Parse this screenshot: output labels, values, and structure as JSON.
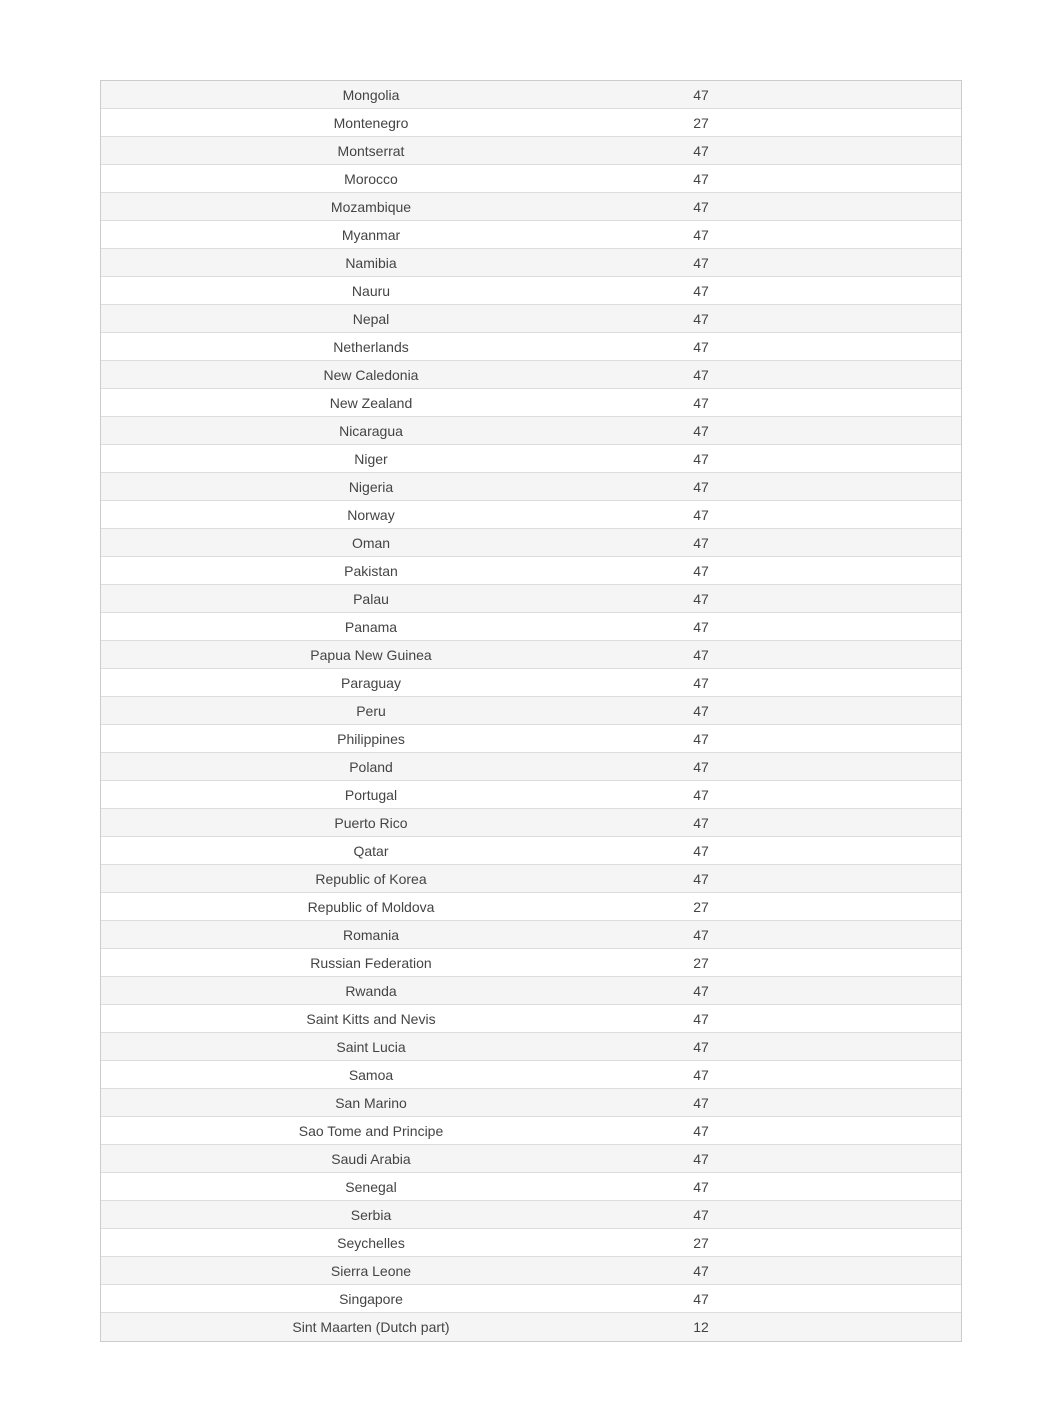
{
  "rows": [
    {
      "country": "Mongolia",
      "value": "47"
    },
    {
      "country": "Montenegro",
      "value": "27"
    },
    {
      "country": "Montserrat",
      "value": "47"
    },
    {
      "country": "Morocco",
      "value": "47"
    },
    {
      "country": "Mozambique",
      "value": "47"
    },
    {
      "country": "Myanmar",
      "value": "47"
    },
    {
      "country": "Namibia",
      "value": "47"
    },
    {
      "country": "Nauru",
      "value": "47"
    },
    {
      "country": "Nepal",
      "value": "47"
    },
    {
      "country": "Netherlands",
      "value": "47"
    },
    {
      "country": "New Caledonia",
      "value": "47"
    },
    {
      "country": "New Zealand",
      "value": "47"
    },
    {
      "country": "Nicaragua",
      "value": "47"
    },
    {
      "country": "Niger",
      "value": "47"
    },
    {
      "country": "Nigeria",
      "value": "47"
    },
    {
      "country": "Norway",
      "value": "47"
    },
    {
      "country": "Oman",
      "value": "47"
    },
    {
      "country": "Pakistan",
      "value": "47"
    },
    {
      "country": "Palau",
      "value": "47"
    },
    {
      "country": "Panama",
      "value": "47"
    },
    {
      "country": "Papua New Guinea",
      "value": "47"
    },
    {
      "country": "Paraguay",
      "value": "47"
    },
    {
      "country": "Peru",
      "value": "47"
    },
    {
      "country": "Philippines",
      "value": "47"
    },
    {
      "country": "Poland",
      "value": "47"
    },
    {
      "country": "Portugal",
      "value": "47"
    },
    {
      "country": "Puerto Rico",
      "value": "47"
    },
    {
      "country": "Qatar",
      "value": "47"
    },
    {
      "country": "Republic of Korea",
      "value": "47"
    },
    {
      "country": "Republic of Moldova",
      "value": "27"
    },
    {
      "country": "Romania",
      "value": "47"
    },
    {
      "country": "Russian Federation",
      "value": "27"
    },
    {
      "country": "Rwanda",
      "value": "47"
    },
    {
      "country": "Saint Kitts and Nevis",
      "value": "47"
    },
    {
      "country": "Saint Lucia",
      "value": "47"
    },
    {
      "country": "Samoa",
      "value": "47"
    },
    {
      "country": "San Marino",
      "value": "47"
    },
    {
      "country": "Sao Tome and Principe",
      "value": "47"
    },
    {
      "country": "Saudi Arabia",
      "value": "47"
    },
    {
      "country": "Senegal",
      "value": "47"
    },
    {
      "country": "Serbia",
      "value": "47"
    },
    {
      "country": "Seychelles",
      "value": "27"
    },
    {
      "country": "Sierra Leone",
      "value": "47"
    },
    {
      "country": "Singapore",
      "value": "47"
    },
    {
      "country": "Sint Maarten (Dutch part)",
      "value": "12"
    }
  ]
}
